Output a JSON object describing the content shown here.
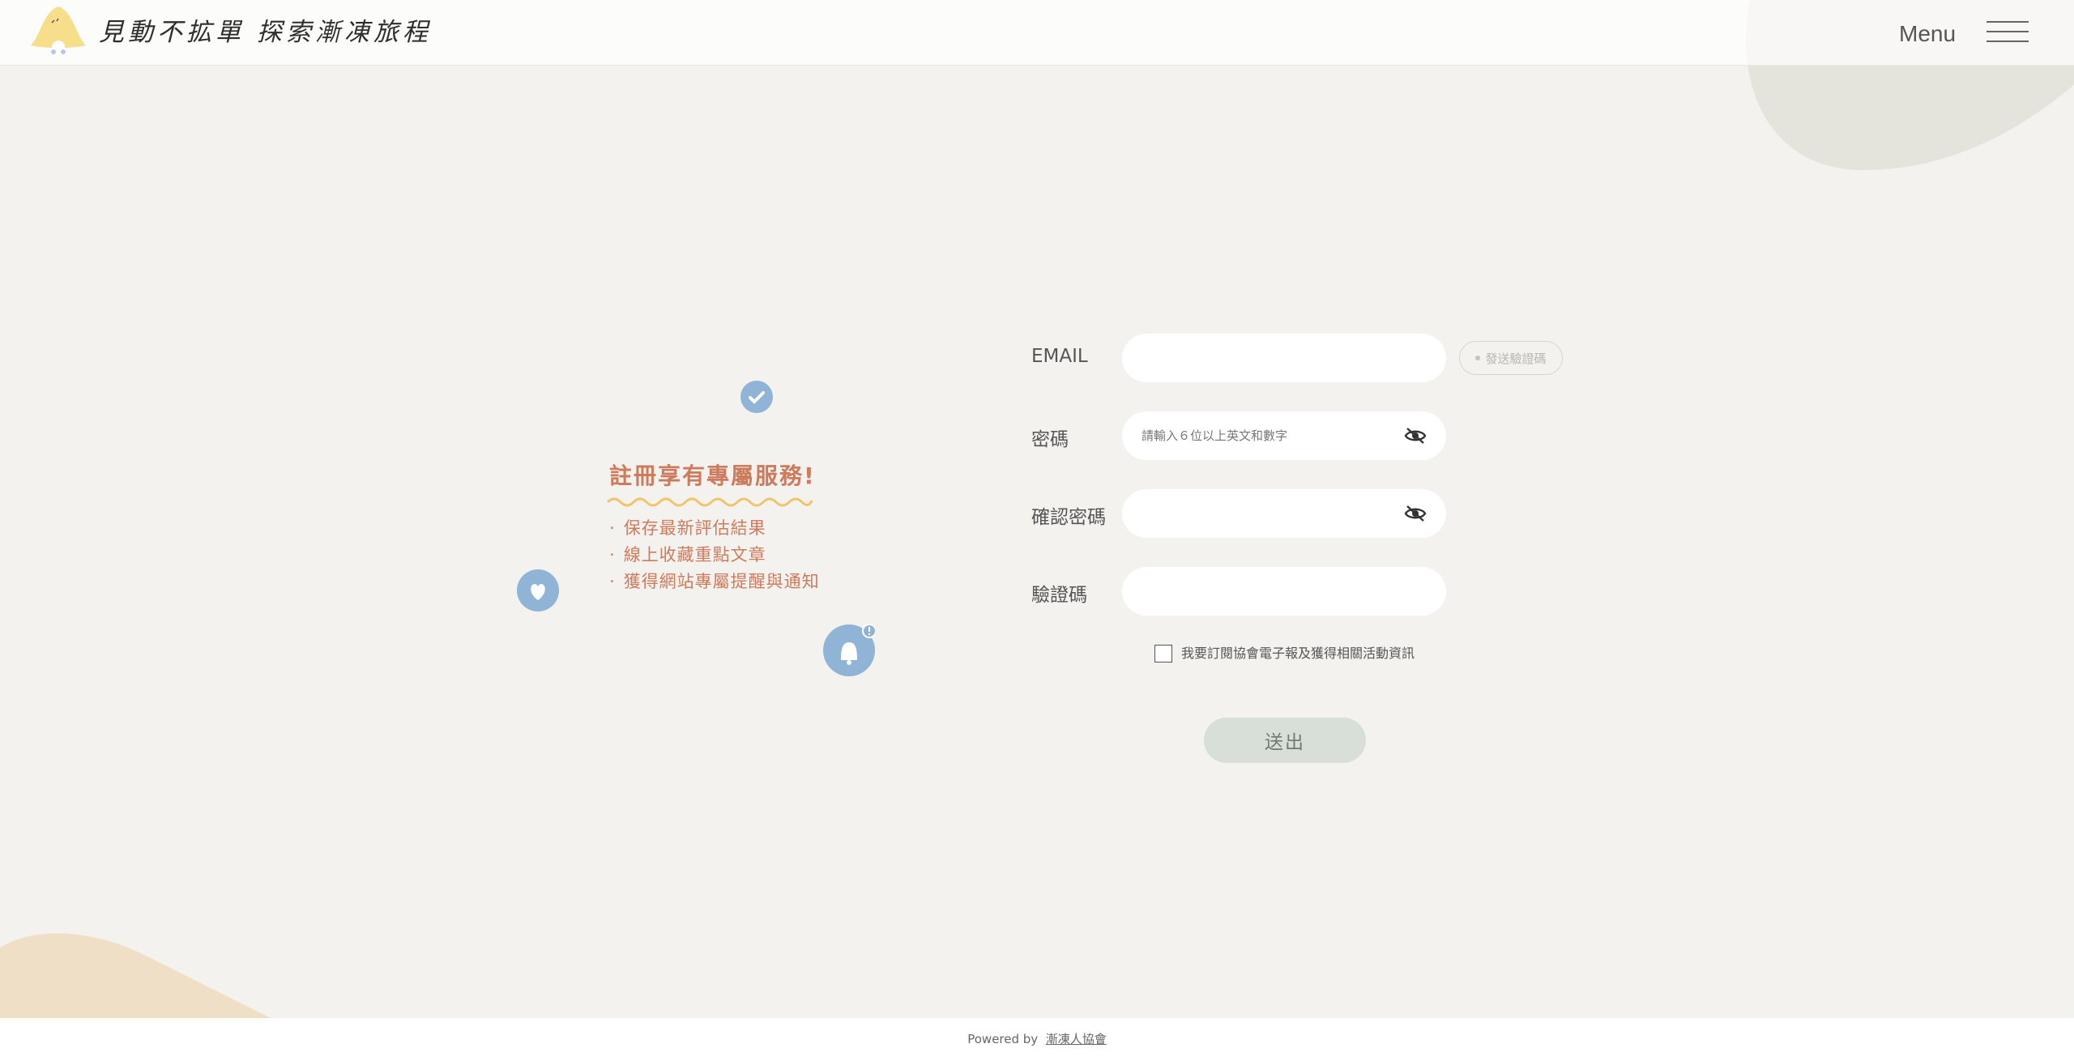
{
  "header": {
    "site_title": "見動不拡單 探索漸凍旅程",
    "menu_label": "Menu"
  },
  "promo": {
    "title": "註冊享有專屬服務!",
    "benefits": [
      "保存最新評估結果",
      "線上收藏重點文章",
      "獲得網站專屬提醒與通知"
    ]
  },
  "form": {
    "email_label": "EMAIL",
    "send_code_label": "發送驗證碼",
    "password_label": "密碼",
    "password_placeholder": "請輸入６位以上英文和數字",
    "confirm_password_label": "確認密碼",
    "verify_code_label": "驗證碼",
    "subscribe_label": "我要訂閱協會電子報及獲得相關活動資訊",
    "subscribe_checked": false,
    "submit_label": "送出"
  },
  "footer": {
    "powered_by": "Powered by",
    "org_link": "漸凍人協會"
  },
  "colors": {
    "background": "#f3f2ee",
    "accent": "#cd7b5d",
    "icon_blue": "#8fb4d6",
    "submit_bg": "#d8ded8",
    "wave_yellow": "#f1c46a",
    "blob_beige": "#f0dfc7",
    "blob_gray": "#e4e3dc"
  },
  "icons": {
    "check": "check-icon",
    "heart": "heart-icon",
    "bell": "bell-icon",
    "eye": "eye-off-icon",
    "menu": "hamburger-icon"
  }
}
